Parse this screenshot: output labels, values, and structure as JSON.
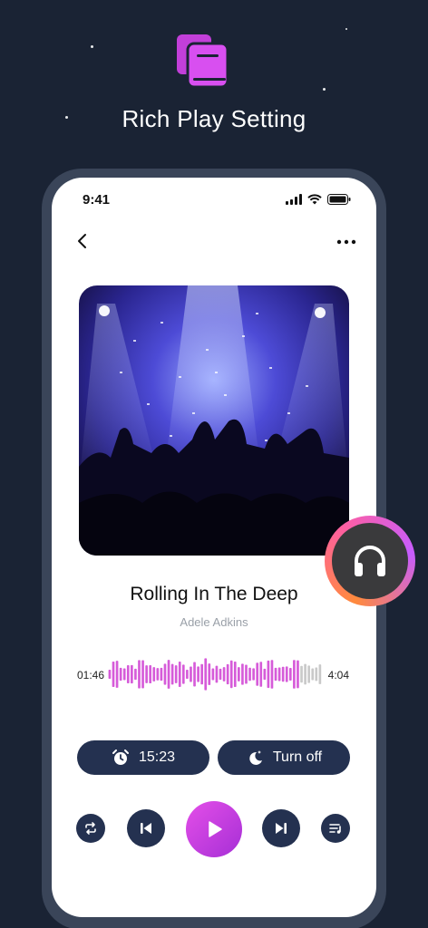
{
  "promo": {
    "title": "Rich Play Setting"
  },
  "status_bar": {
    "time": "9:41"
  },
  "track": {
    "title": "Rolling In The Deep",
    "artist": "Adele Adkins",
    "elapsed": "01:46",
    "duration": "4:04",
    "progress_fraction": 0.9
  },
  "timer": {
    "alarm_label": "15:23",
    "sleep_label": "Turn off"
  },
  "colors": {
    "background": "#1a2334",
    "accent_pink": "#e44fe8",
    "accent_purple": "#a62fd6",
    "control_navy": "#243150",
    "waveform_played": "#d65bd9",
    "waveform_remaining": "#c9c9c9"
  },
  "icons": {
    "logo": "book-library-icon",
    "back": "chevron-left-icon",
    "more": "more-horizontal-icon",
    "alarm": "alarm-clock-icon",
    "sleep": "moon-stars-icon",
    "repeat": "repeat-icon",
    "previous": "skip-previous-icon",
    "play": "play-icon",
    "next": "skip-next-icon",
    "queue": "playlist-icon",
    "headphones": "headphones-icon"
  }
}
